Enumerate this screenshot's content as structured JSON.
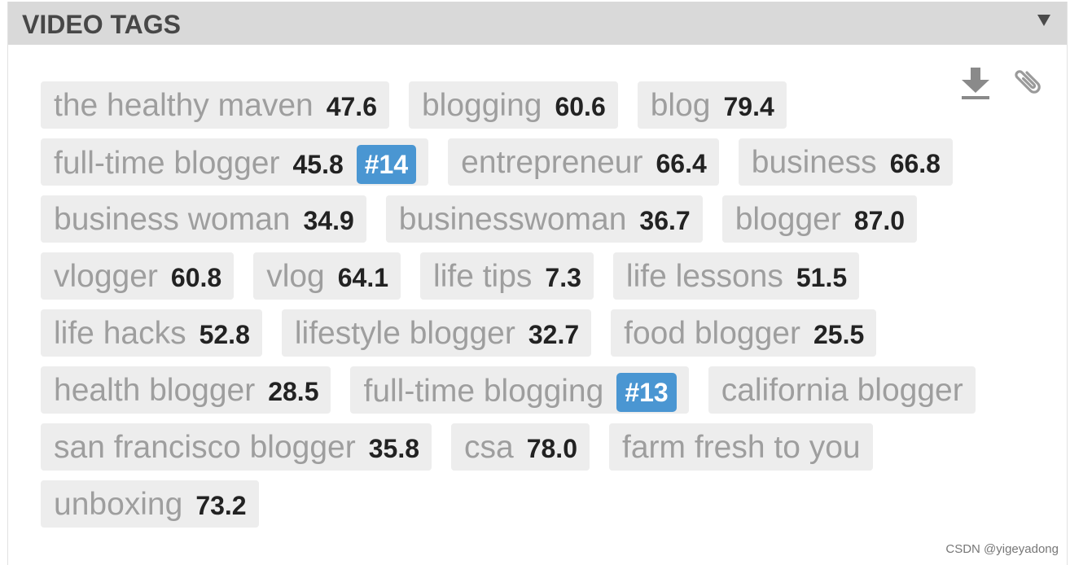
{
  "panel": {
    "title": "VIDEO TAGS",
    "collapse_icon": "triangle-down-icon"
  },
  "toolbar": {
    "download_icon": "download-icon",
    "copy_icon": "paperclip-icon"
  },
  "tags": [
    {
      "text": "the healthy maven",
      "score": "47.6"
    },
    {
      "text": "blogging",
      "score": "60.6"
    },
    {
      "text": "blog",
      "score": "79.4"
    },
    {
      "text": "full-time blogger",
      "score": "45.8",
      "rank": "#14"
    },
    {
      "text": "entrepreneur",
      "score": "66.4"
    },
    {
      "text": "business",
      "score": "66.8"
    },
    {
      "text": "business woman",
      "score": "34.9"
    },
    {
      "text": "businesswoman",
      "score": "36.7"
    },
    {
      "text": "blogger",
      "score": "87.0"
    },
    {
      "text": "vlogger",
      "score": "60.8"
    },
    {
      "text": "vlog",
      "score": "64.1"
    },
    {
      "text": "life tips",
      "score": "7.3"
    },
    {
      "text": "life lessons",
      "score": "51.5"
    },
    {
      "text": "life hacks",
      "score": "52.8"
    },
    {
      "text": "lifestyle blogger",
      "score": "32.7"
    },
    {
      "text": "food blogger",
      "score": "25.5"
    },
    {
      "text": "health blogger",
      "score": "28.5"
    },
    {
      "text": "full-time blogging",
      "rank": "#13"
    },
    {
      "text": "california blogger"
    },
    {
      "text": "san francisco blogger",
      "score": "35.8"
    },
    {
      "text": "csa",
      "score": "78.0"
    },
    {
      "text": "farm fresh to you"
    },
    {
      "text": "unboxing",
      "score": "73.2"
    }
  ],
  "watermark": "CSDN @yigeyadong",
  "colors": {
    "header_bg": "#d9d9d9",
    "tag_bg": "#ededed",
    "tag_text": "#9e9e9e",
    "score_text": "#222222",
    "rank_badge": "#4a96d2"
  }
}
